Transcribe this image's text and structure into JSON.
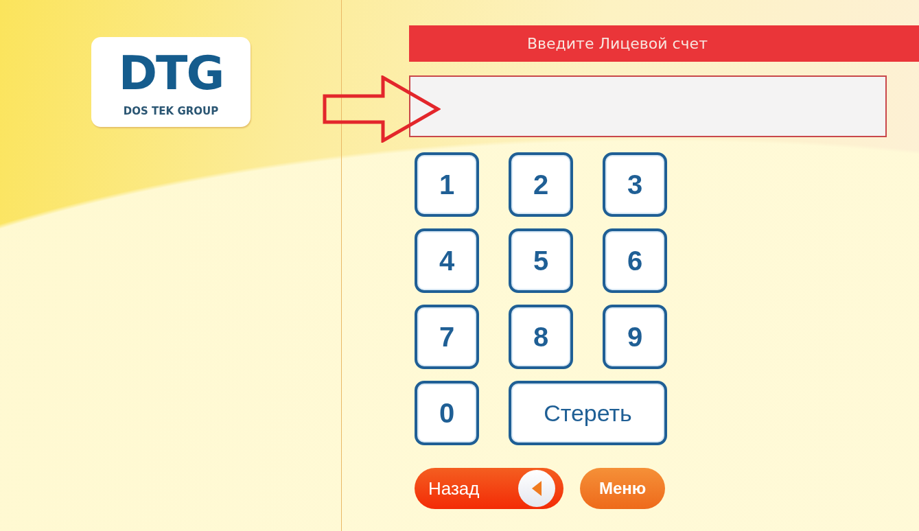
{
  "logo": {
    "title": "DTG",
    "subtitle": "DOS TEK GROUP"
  },
  "header": {
    "title": "Введите Лицевой счет"
  },
  "keypad": [
    {
      "label": "1",
      "kind": "digit"
    },
    {
      "label": "2",
      "kind": "digit"
    },
    {
      "label": "3",
      "kind": "digit"
    },
    {
      "label": "4",
      "kind": "digit"
    },
    {
      "label": "5",
      "kind": "digit"
    },
    {
      "label": "6",
      "kind": "digit"
    },
    {
      "label": "7",
      "kind": "digit"
    },
    {
      "label": "8",
      "kind": "digit"
    },
    {
      "label": "9",
      "kind": "digit"
    },
    {
      "label": "0",
      "kind": "digit"
    },
    {
      "label": "Стереть",
      "kind": "erase"
    }
  ],
  "nav_buttons": [
    {
      "label": "Назад",
      "kind": "back"
    },
    {
      "label": "Меню",
      "kind": "menu"
    }
  ]
}
